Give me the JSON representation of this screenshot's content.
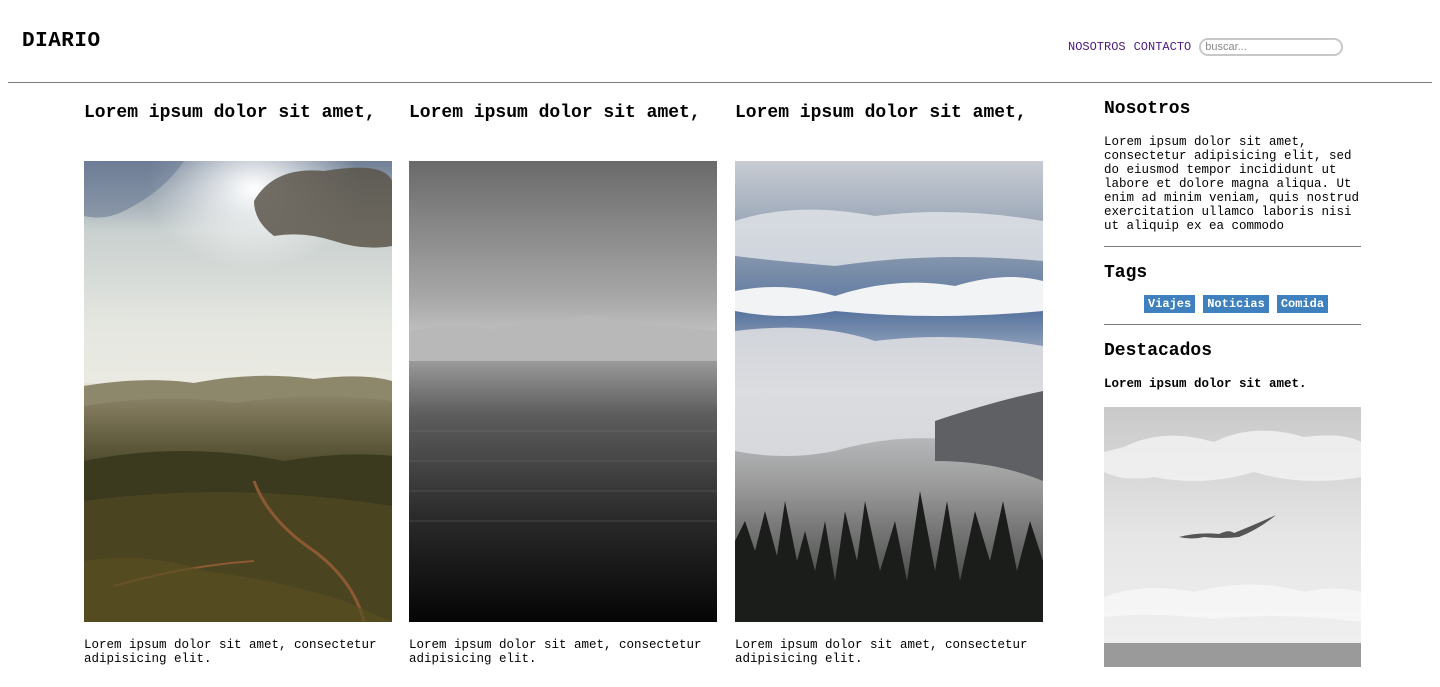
{
  "header": {
    "logo": "DIARIO",
    "nav": [
      "NOSOTROS",
      "CONTACTO"
    ],
    "search_placeholder": "buscar..."
  },
  "articles": [
    {
      "title": "Lorem ipsum dolor sit amet,",
      "excerpt": "Lorem ipsum dolor sit amet, consectetur adipisicing elit."
    },
    {
      "title": "Lorem ipsum dolor sit amet,",
      "excerpt": "Lorem ipsum dolor sit amet, consectetur adipisicing elit."
    },
    {
      "title": "Lorem ipsum dolor sit amet,",
      "excerpt": "Lorem ipsum dolor sit amet, consectetur adipisicing elit."
    }
  ],
  "sidebar": {
    "about_title": "Nosotros",
    "about_text": "Lorem ipsum dolor sit amet, consectetur adipisicing elit, sed do eiusmod tempor incididunt ut labore et dolore magna aliqua. Ut enim ad minim veniam, quis nostrud exercitation ullamco laboris nisi ut aliquip ex ea commodo",
    "tags_title": "Tags",
    "tags": [
      "Viajes",
      "Noticias",
      "Comida"
    ],
    "featured_title": "Destacados",
    "featured_item": "Lorem ipsum dolor sit amet."
  },
  "colors": {
    "nav_link": "#4b1782",
    "tag_bg": "#3f80bf",
    "divider": "#7a7a7a"
  }
}
